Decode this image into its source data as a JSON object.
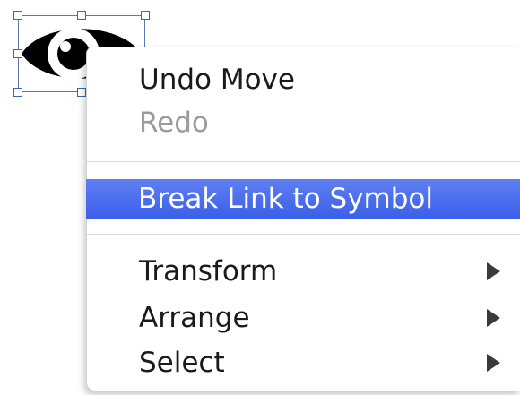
{
  "canvas": {
    "selected_symbol_icon": "eye-symbol-icon"
  },
  "context_menu": {
    "items": [
      {
        "label": "Undo Move",
        "enabled": true
      },
      {
        "label": "Redo",
        "enabled": false
      },
      {
        "label": "Break Link to Symbol",
        "enabled": true,
        "highlighted": true
      },
      {
        "label": "Transform",
        "enabled": true,
        "submenu": true
      },
      {
        "label": "Arrange",
        "enabled": true,
        "submenu": true
      },
      {
        "label": "Select",
        "enabled": true,
        "submenu": true
      }
    ],
    "submenu_arrow_icon": "chevron-right-icon",
    "highlight_color": "#4a6ff0"
  }
}
